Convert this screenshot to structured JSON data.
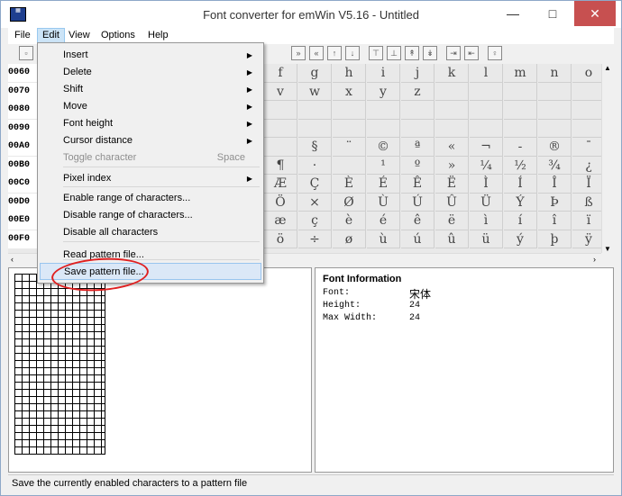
{
  "window": {
    "title": "Font converter for emWin V5.16 - Untitled"
  },
  "menubar": [
    "File",
    "Edit",
    "View",
    "Options",
    "Help"
  ],
  "code_column": [
    "0060",
    "0070",
    "0080",
    "0090",
    "00A0",
    "00B0",
    "00C0",
    "00D0",
    "00E0",
    "00F0"
  ],
  "glyph_rows": [
    [
      "f",
      "g",
      "h",
      "i",
      "j",
      "k",
      "l",
      "m",
      "n",
      "o"
    ],
    [
      "v",
      "w",
      "x",
      "y",
      "z",
      "",
      "",
      "",
      "",
      ""
    ],
    [
      "",
      "",
      "",
      "",
      "",
      "",
      "",
      "",
      "",
      ""
    ],
    [
      "",
      "",
      "",
      "",
      "",
      "",
      "",
      "",
      "",
      ""
    ],
    [
      "",
      "§",
      "¨",
      "©",
      "ª",
      "«",
      "¬",
      "-",
      "®",
      "¯"
    ],
    [
      "¶",
      "·",
      "",
      "¹",
      "º",
      "»",
      "¼",
      "½",
      "¾",
      "¿"
    ],
    [
      "Æ",
      "Ç",
      "È",
      "É",
      "Ê",
      "Ë",
      "Ì",
      "Í",
      "Î",
      "Ï"
    ],
    [
      "Ö",
      "×",
      "Ø",
      "Ù",
      "Ú",
      "Û",
      "Ü",
      "Ý",
      "Þ",
      "ß"
    ],
    [
      "æ",
      "ç",
      "è",
      "é",
      "ê",
      "ë",
      "ì",
      "í",
      "î",
      "ï"
    ],
    [
      "ö",
      "÷",
      "ø",
      "ù",
      "ú",
      "û",
      "ü",
      "ý",
      "þ",
      "ÿ"
    ]
  ],
  "edit_menu": {
    "items": [
      {
        "label": "Insert",
        "submenu": true
      },
      {
        "label": "Delete",
        "submenu": true
      },
      {
        "label": "Shift",
        "submenu": true
      },
      {
        "label": "Move",
        "submenu": true
      },
      {
        "label": "Font height",
        "submenu": true
      },
      {
        "label": "Cursor distance",
        "submenu": true
      },
      {
        "label": "Toggle character",
        "shortcut": "Space",
        "disabled": true
      },
      {
        "label": "Pixel index",
        "submenu": true
      },
      {
        "label": "Enable range of characters..."
      },
      {
        "label": "Disable range of characters..."
      },
      {
        "label": "Disable all characters"
      },
      {
        "label": "Read pattern file..."
      },
      {
        "label": "Save pattern file...",
        "highlighted": true
      }
    ]
  },
  "font_info": {
    "title": "Font Information",
    "labels": [
      "Font:",
      "Height:",
      "Max Width:"
    ],
    "values": [
      "宋体",
      "24",
      "24"
    ]
  },
  "statusbar": {
    "text": "Save the currently enabled characters to a pattern file"
  },
  "colors": {
    "accent": "#99c9ef",
    "highlight": "#dbe8f7",
    "annotation": "#e02020",
    "close": "#c75050"
  },
  "icons": [
    "app-icon",
    "minimize-icon",
    "maximize-icon",
    "close-icon",
    "submenu-arrow-icon",
    "scroll-arrow-icon"
  ]
}
